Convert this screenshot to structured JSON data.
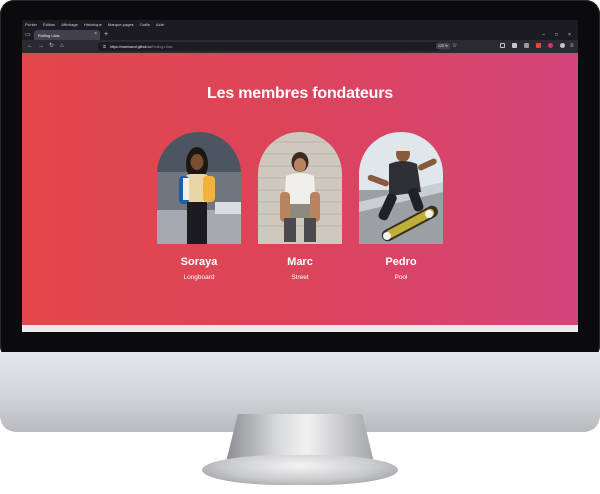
{
  "browser": {
    "menu": [
      "Fichier",
      "Édition",
      "Affichage",
      "Historique",
      "Marque-pages",
      "Outils",
      "Aide"
    ],
    "tab_title": "Rolling Lilas",
    "tab_close": "×",
    "new_tab": "+",
    "url_host": "https://marinaxuf.github.io",
    "url_path": "/Rolling-Lilas/",
    "zoom": "120 %",
    "nav_back": "←",
    "nav_forward": "→",
    "nav_reload": "↻",
    "nav_home": "⌂",
    "star": "☆",
    "lock": "🔒",
    "win_min": "–",
    "win_max": "□",
    "win_close": "×"
  },
  "page": {
    "title": "Les membres fondateurs",
    "members": [
      {
        "name": "Soraya",
        "style": "Longboard"
      },
      {
        "name": "Marc",
        "style": "Street"
      },
      {
        "name": "Pedro",
        "style": "Pool"
      }
    ]
  },
  "colors": {
    "gradient_start": "#e2474b",
    "gradient_end": "#d3447a",
    "browser_chrome": "#1c1b22",
    "tab_active": "#42414d"
  }
}
